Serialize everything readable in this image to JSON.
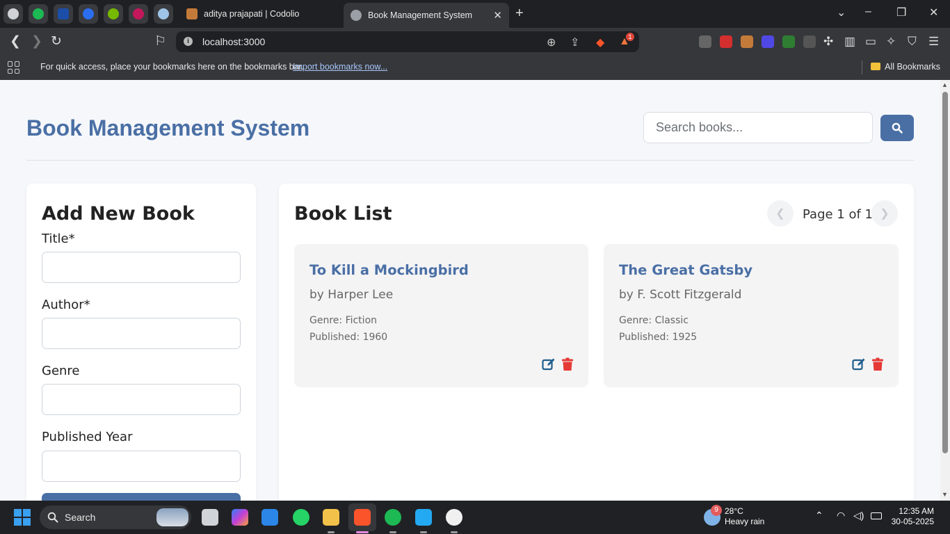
{
  "browser": {
    "tabs": [
      {
        "title": "aditya prajapati | Codolio",
        "active": false
      },
      {
        "title": "Book Management System",
        "active": true
      }
    ],
    "url": "localhost:3000",
    "extension_badge": "1",
    "bookmarks_bar": {
      "message": "For quick access, place your bookmarks here on the bookmarks bar.",
      "import_link": "Import bookmarks now...",
      "all_bookmarks": "All Bookmarks"
    }
  },
  "app": {
    "title": "Book Management System",
    "search": {
      "placeholder": "Search books..."
    },
    "form": {
      "heading": "Add New Book",
      "fields": [
        {
          "label": "Title*",
          "value": ""
        },
        {
          "label": "Author*",
          "value": ""
        },
        {
          "label": "Genre",
          "value": ""
        },
        {
          "label": "Published Year",
          "value": ""
        }
      ]
    },
    "list": {
      "heading": "Book List",
      "pagination": "Page 1 of 1",
      "books": [
        {
          "title": "To Kill a Mockingbird",
          "author": "by Harper Lee",
          "genre": "Genre: Fiction",
          "published": "Published: 1960"
        },
        {
          "title": "The Great Gatsby",
          "author": "by F. Scott Fitzgerald",
          "genre": "Genre: Classic",
          "published": "Published: 1925"
        }
      ]
    }
  },
  "taskbar": {
    "search_label": "Search",
    "weather": {
      "temp": "28°C",
      "condition": "Heavy rain",
      "badge": "9"
    },
    "clock": {
      "time": "12:35 AM",
      "date": "30-05-2025"
    }
  },
  "colors": {
    "accent": "#4a6fa5",
    "delete": "#e53935",
    "edit": "#1f5e8c"
  }
}
